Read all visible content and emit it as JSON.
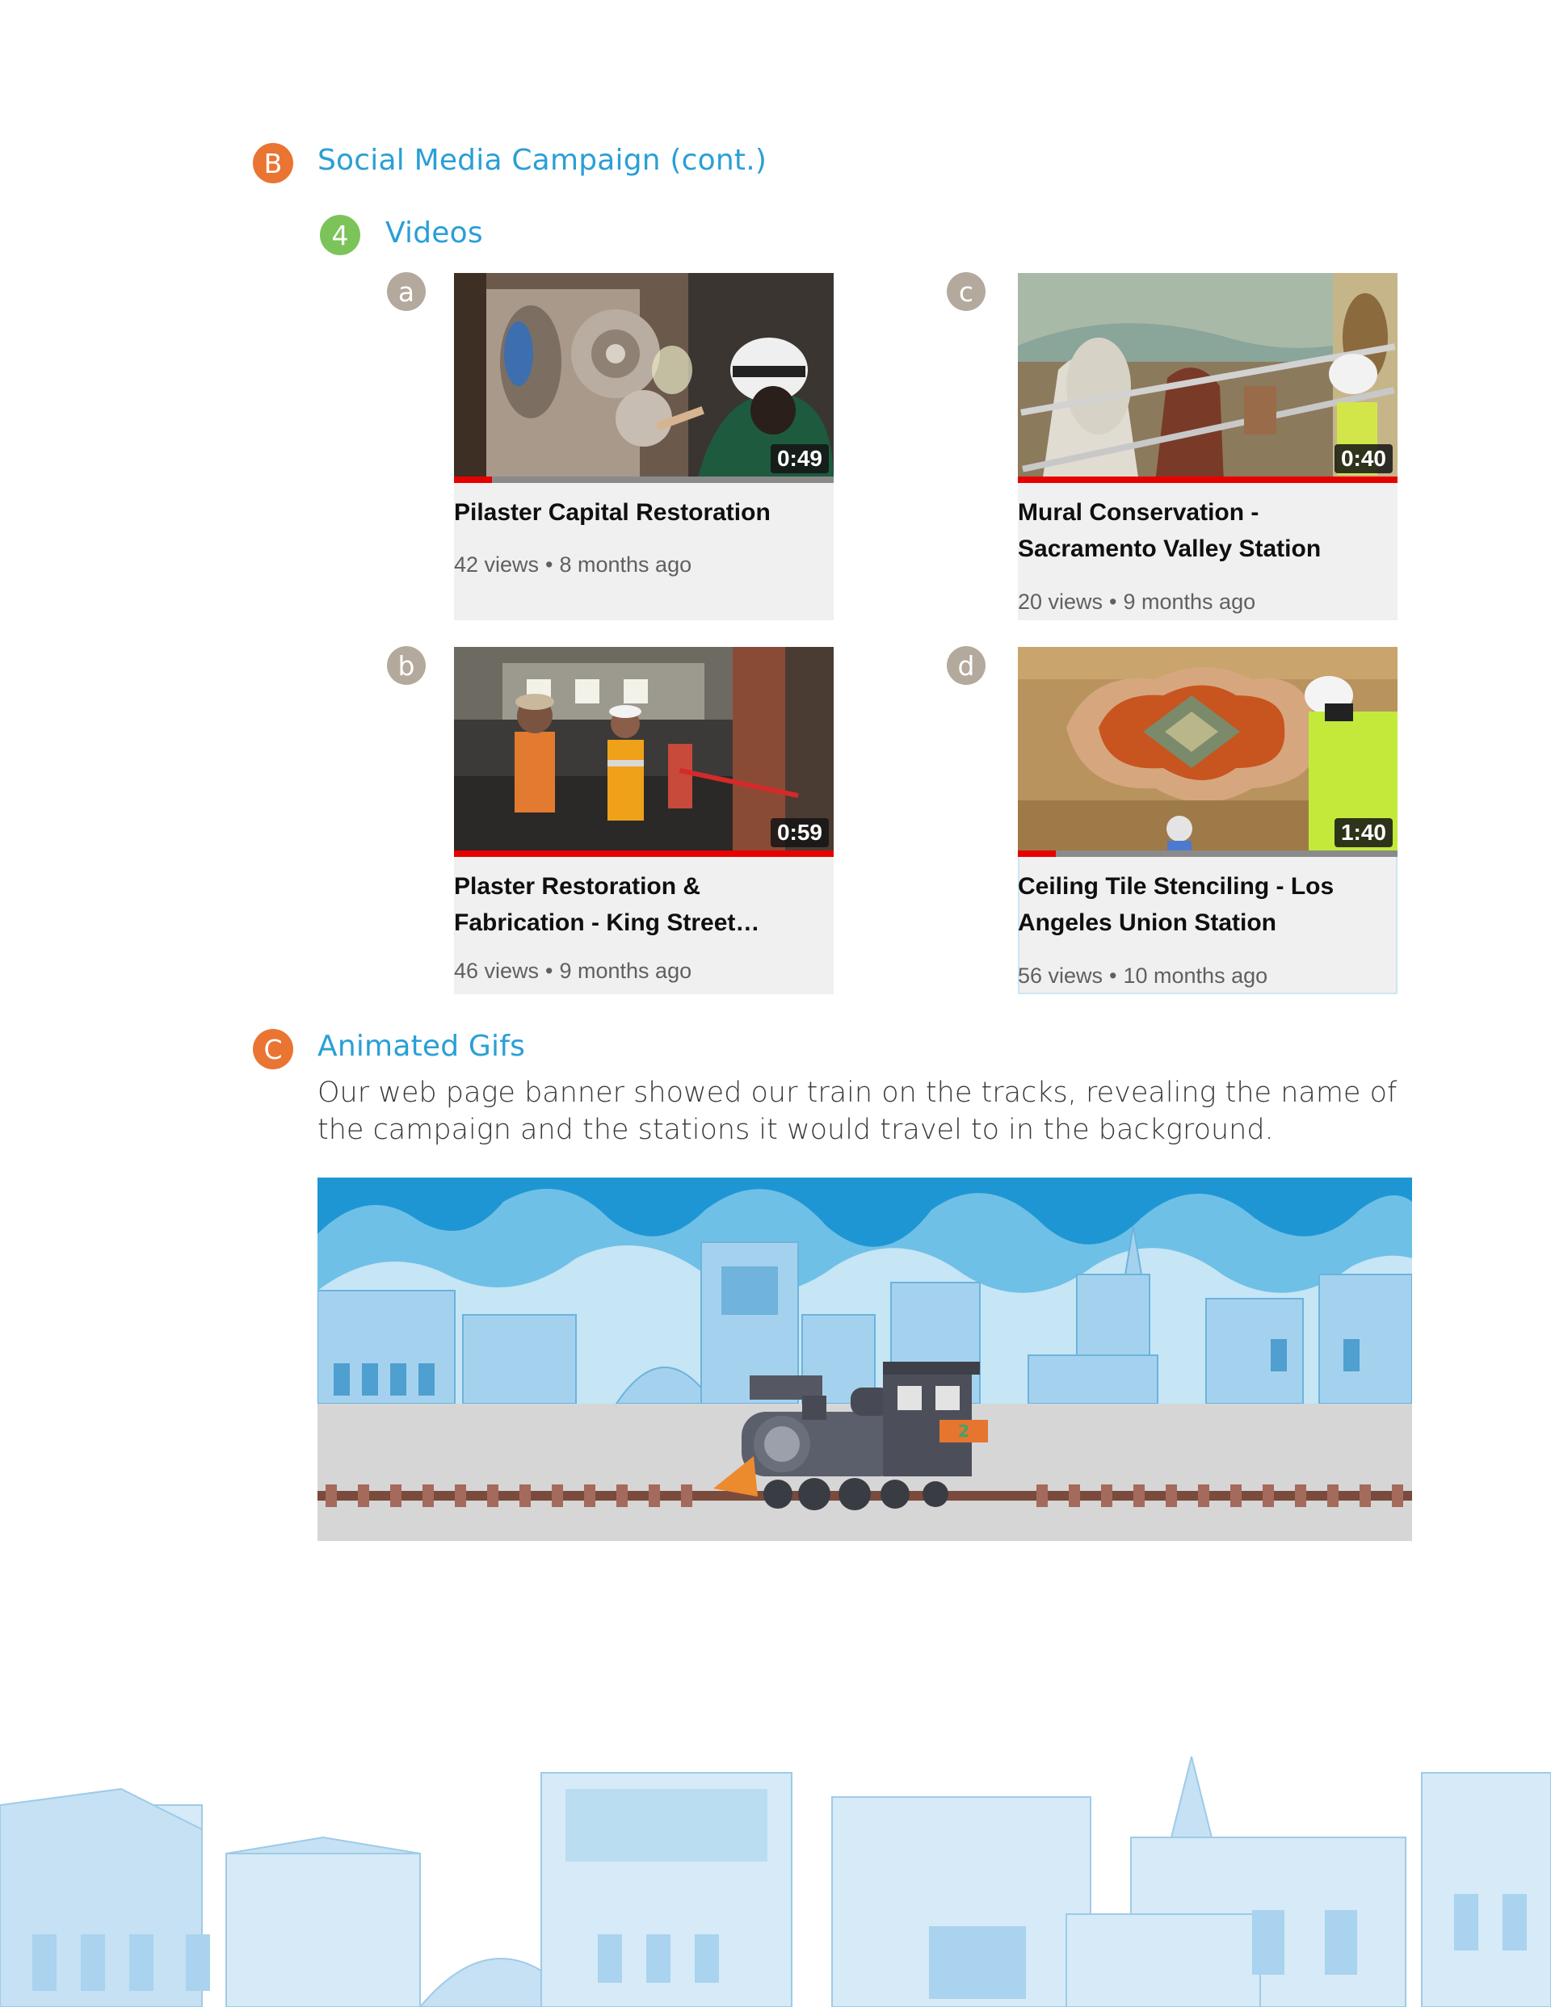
{
  "section_b": {
    "letter": "B",
    "title": "Social Media Campaign (cont.)"
  },
  "videos_heading": {
    "number": "4",
    "title": "Videos"
  },
  "videos": [
    {
      "tag": "a",
      "title": "Pilaster Capital Restoration",
      "views": "42 views",
      "age": "8 months ago",
      "duration": "0:49",
      "progress": 0.1
    },
    {
      "tag": "b",
      "title": "Plaster Restoration & Fabrication - King Street…",
      "views": "46 views",
      "age": "9 months ago",
      "duration": "0:59",
      "progress": 1.0
    },
    {
      "tag": "c",
      "title": "Mural Conservation - Sacramento Valley Station",
      "views": "20 views",
      "age": "9 months ago",
      "duration": "0:40",
      "progress": 1.0
    },
    {
      "tag": "d",
      "title": "Ceiling Tile Stenciling - Los Angeles Union Station",
      "views": "56 views",
      "age": "10 months ago",
      "duration": "1:40",
      "progress": 0.1
    }
  ],
  "meta_separator": "•",
  "section_c": {
    "letter": "C",
    "title": "Animated Gifs",
    "paragraph": "Our web page banner showed our train on the tracks, revealing the name of the campaign and the stations it would travel to in the background."
  },
  "banner": {
    "locomotive_number": "2"
  },
  "colors": {
    "accent_blue": "#2a9fd6",
    "badge_orange": "#ea7431",
    "badge_green": "#7cc35a",
    "badge_gray": "#b3a99c",
    "progress_red": "#e60000"
  }
}
